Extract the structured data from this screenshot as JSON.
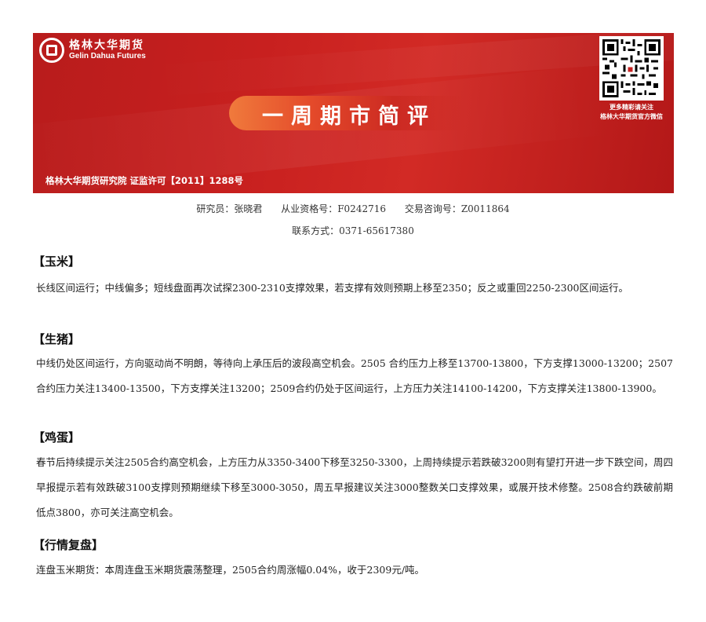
{
  "banner": {
    "logo_cn": "格林大华期货",
    "logo_en": "Gelin Dahua Futures",
    "title": "一周期市简评",
    "qr_caption_line1": "更多精彩请关注",
    "qr_caption_line2": "格林大华期货官方微信",
    "license": "格林大华期货研究院  证监许可【2011】1288号"
  },
  "meta": {
    "researcher": "研究员：张晓君",
    "qualification": "从业资格号：F0242716",
    "consult": "交易咨询号：Z0011864",
    "contact": "联系方式：0371-65617380"
  },
  "sections": {
    "corn": {
      "heading": "【玉米】",
      "text": "长线区间运行；中线偏多；短线盘面再次试探2300-2310支撑效果，若支撑有效则预期上移至2350；反之或重回2250-2300区间运行。"
    },
    "hog": {
      "heading": "【生猪】",
      "text": "中线仍处区间运行，方向驱动尚不明朗，等待向上承压后的波段高空机会。2505 合约压力上移至13700-13800，下方支撑13000-13200；2507合约压力关注13400-13500，下方支撑关注13200；2509合约仍处于区间运行，上方压力关注14100-14200，下方支撑关注13800-13900。"
    },
    "egg": {
      "heading": "【鸡蛋】",
      "text": "春节后持续提示关注2505合约高空机会，上方压力从3350-3400下移至3250-3300，上周持续提示若跌破3200则有望打开进一步下跌空间，周四早报提示若有效跌破3100支撑则预期继续下移至3000-3050，周五早报建议关注3000整数关口支撑效果，或展开技术修整。2508合约跌破前期低点3800，亦可关注高空机会。"
    },
    "review": {
      "heading": "【行情复盘】",
      "text": "连盘玉米期货：本周连盘玉米期货震荡整理，2505合约周涨幅0.04%，收于2309元/吨。"
    }
  }
}
